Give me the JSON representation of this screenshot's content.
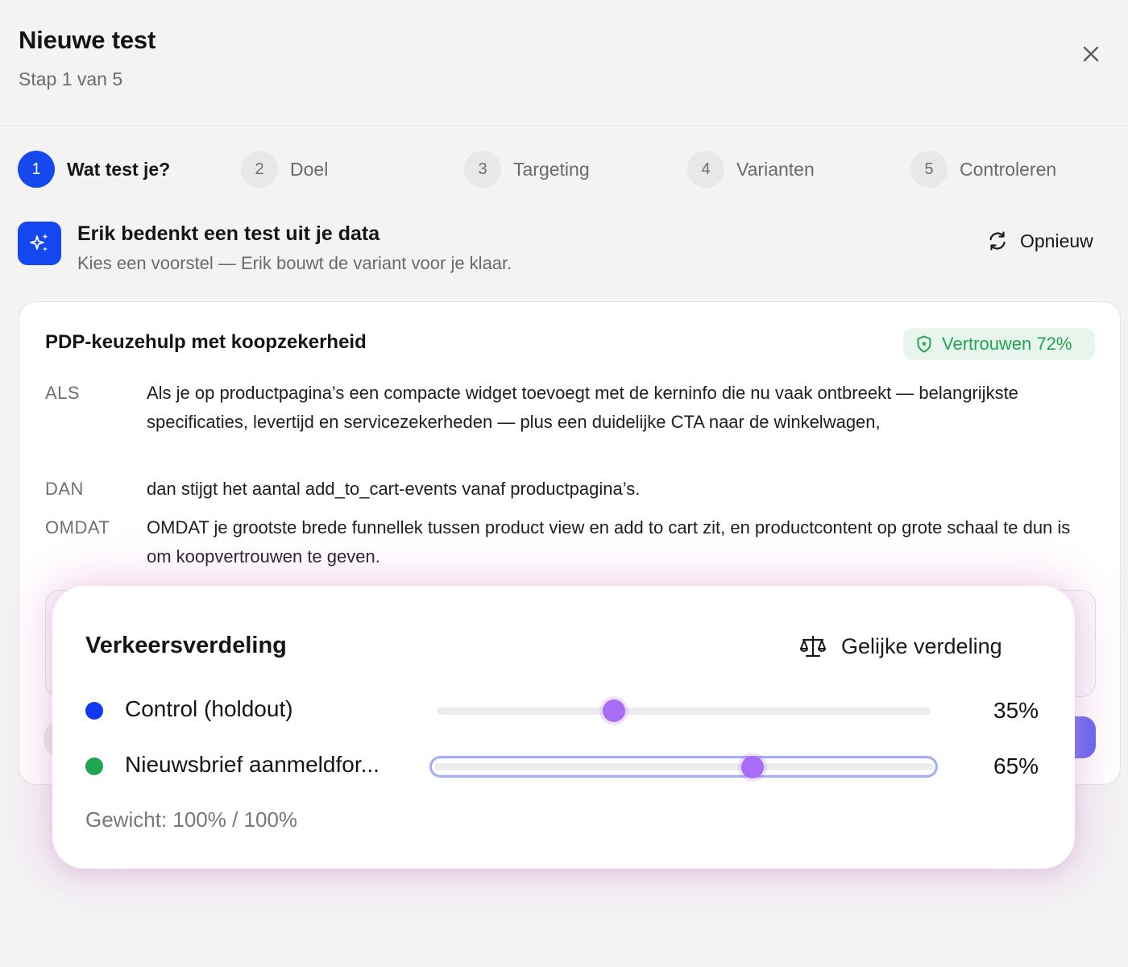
{
  "header": {
    "title": "Nieuwe test",
    "subtitle": "Stap 1 van 5",
    "close_icon": "close-icon"
  },
  "stepper": {
    "steps": [
      {
        "number": "1",
        "label": "Wat test je?",
        "active": true
      },
      {
        "number": "2",
        "label": "Doel",
        "active": false
      },
      {
        "number": "3",
        "label": "Targeting",
        "active": false
      },
      {
        "number": "4",
        "label": "Varianten",
        "active": false
      },
      {
        "number": "5",
        "label": "Controleren",
        "active": false
      }
    ]
  },
  "ai_banner": {
    "icon": "sparkles-icon",
    "title": "Erik bedenkt een test uit je data",
    "subtitle": "Kies een voorstel — Erik bouwt de variant voor je klaar.",
    "retry_icon": "refresh-icon",
    "retry_label": "Opnieuw"
  },
  "proposal": {
    "title": "PDP-keuzehulp met koopzekerheid",
    "confidence_icon": "shield-icon",
    "confidence_label": "Vertrouwen 72%",
    "hypothesis": [
      {
        "key": "ALS",
        "text": "Als je op productpagina’s een compacte widget toevoegt met de kerninfo die nu vaak ontbreekt — belangrijkste specificaties, levertijd en servicezekerheden — plus een duidelijke CTA naar de winkelwagen,"
      },
      {
        "key": "DAN",
        "text": "dan stijgt het aantal add_to_cart-events vanaf productpagina’s."
      },
      {
        "key": "OMDAT",
        "text": "OMDAT je grootste brede funnellek tussen product view en add to cart zit, en productcontent op grote schaal te dun is om koopvertrouwen te geven."
      }
    ]
  },
  "traffic": {
    "title": "Verkeersverdeling",
    "equal_icon": "balance-scale-icon",
    "equal_label": "Gelijke verdeling",
    "rows": [
      {
        "label": "Control (holdout)",
        "percent": 35,
        "percent_label": "35%",
        "dot_color": "#1238f2",
        "focused": false
      },
      {
        "label": "Nieuwsbrief aanmeldfor...",
        "percent": 65,
        "percent_label": "65%",
        "dot_color": "#1fa552",
        "focused": true
      }
    ],
    "weight_label": "Gewicht: 100% / 100%"
  },
  "colors": {
    "accent": "#1547f0",
    "thumb": "#a86cf7",
    "confidence_green": "#23a455"
  }
}
